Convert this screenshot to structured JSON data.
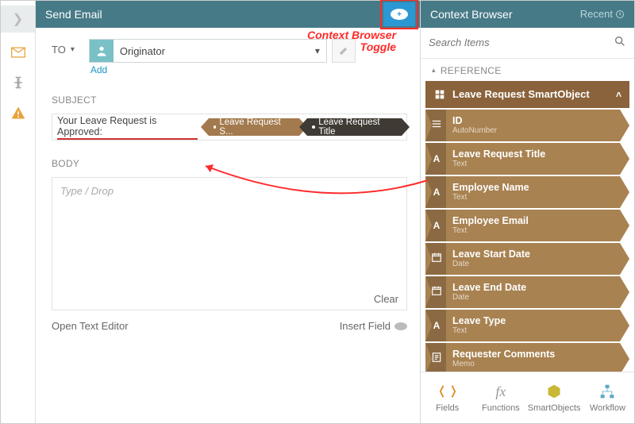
{
  "header": {
    "title": "Send Email"
  },
  "context": {
    "title": "Context Browser",
    "recent": "Recent"
  },
  "to": {
    "label": "TO",
    "value": "Originator",
    "add": "Add"
  },
  "subject": {
    "label": "SUBJECT",
    "text": "Your Leave Request is Approved:",
    "tag1": "Leave Request S...",
    "tag2": "Leave Request Title"
  },
  "body": {
    "label": "BODY",
    "placeholder": "Type / Drop",
    "clear": "Clear"
  },
  "footer": {
    "left": "Open Text Editor",
    "right": "Insert Field"
  },
  "search": {
    "placeholder": "Search Items"
  },
  "reference": {
    "label": "REFERENCE"
  },
  "smartobject": {
    "name": "Leave Request SmartObject",
    "fields": [
      {
        "name": "ID",
        "type": "AutoNumber",
        "icon": "id"
      },
      {
        "name": "Leave Request Title",
        "type": "Text",
        "icon": "A"
      },
      {
        "name": "Employee Name",
        "type": "Text",
        "icon": "A"
      },
      {
        "name": "Employee Email",
        "type": "Text",
        "icon": "A"
      },
      {
        "name": "Leave Start Date",
        "type": "Date",
        "icon": "cal"
      },
      {
        "name": "Leave End Date",
        "type": "Date",
        "icon": "cal"
      },
      {
        "name": "Leave Type",
        "type": "Text",
        "icon": "A"
      },
      {
        "name": "Requester Comments",
        "type": "Memo",
        "icon": "memo"
      }
    ]
  },
  "tabs": {
    "fields": "Fields",
    "functions": "Functions",
    "smartobjects": "SmartObjects",
    "workflow": "Workflow"
  },
  "annotation": {
    "line1": "Context Browser",
    "line2": "Toggle"
  }
}
